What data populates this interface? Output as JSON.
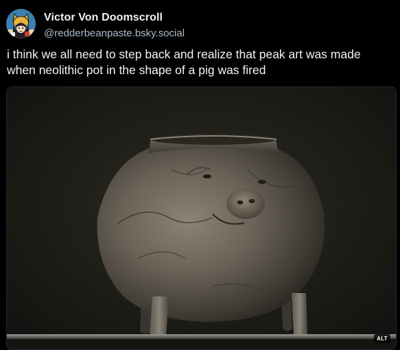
{
  "author": {
    "display_name": "Victor Von Doomscroll",
    "handle": "@redderbeanpaste.bsky.social"
  },
  "post": {
    "text_lines": [
      "i think we all need to step back and realize that peak art was made",
      "when neolithic pot in the shape of a pig was fired"
    ]
  },
  "media": {
    "alt_label": "ALT",
    "subject": "neolithic pig-shaped pottery vessel"
  },
  "colors": {
    "background": "#000000",
    "text_primary": "#f1f3f5",
    "text_secondary": "#aebbc9",
    "avatar_bg": "#3d7fb0"
  }
}
